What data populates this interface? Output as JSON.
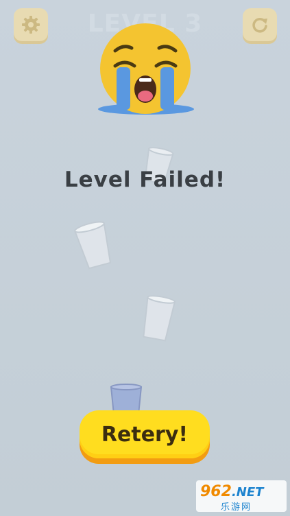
{
  "header": {
    "level_title": "LEVEL 3",
    "settings_icon": "gear-icon",
    "restart_icon": "restart-icon"
  },
  "result": {
    "emoji": "loudly-crying-face",
    "message": "Level Failed!"
  },
  "actions": {
    "retry_label": "Retery!"
  },
  "watermark": {
    "brand": "962",
    "domain": ".NET",
    "subtitle": "乐游网"
  },
  "colors": {
    "background": "#c6d0d8",
    "button_yellow": "#ffdd1f",
    "button_shadow": "#f29c12",
    "top_button": "#ecdcae"
  }
}
